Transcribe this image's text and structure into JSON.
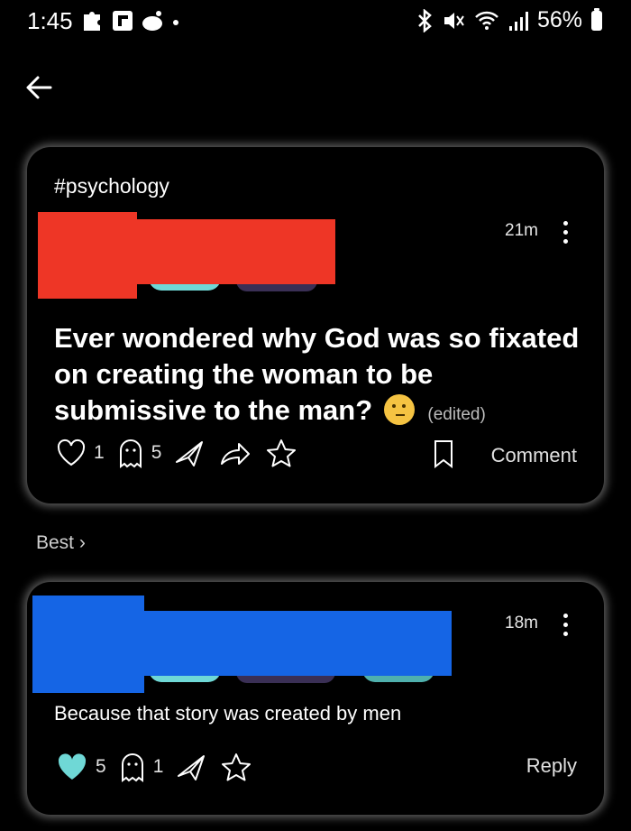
{
  "status_bar": {
    "time": "1:45",
    "battery": "56%"
  },
  "post": {
    "tag": "#psychology",
    "time": "21m",
    "body": "Ever wondered why God was so fixated on creating the woman to be submissive to the man?",
    "edited": "(edited)",
    "like_count": "1",
    "ghost_count": "5",
    "comment_label": "Comment"
  },
  "sort": {
    "label": "Best"
  },
  "comment": {
    "time": "18m",
    "body": "Because that story was created by men",
    "like_count": "5",
    "ghost_count": "1",
    "reply_label": "Reply"
  },
  "colors": {
    "accent_teal": "#6fd8d6",
    "redact_red": "#ee3626",
    "redact_blue": "#1565e5"
  }
}
